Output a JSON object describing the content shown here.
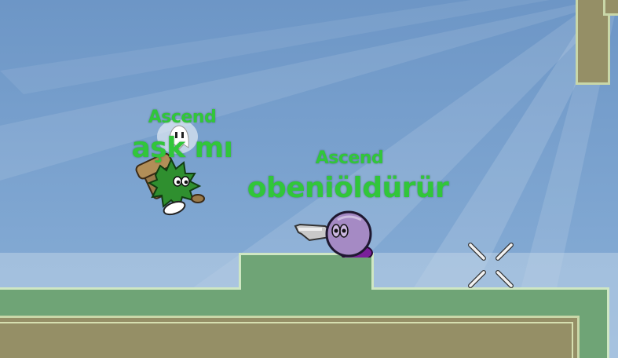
{
  "players": [
    {
      "clan": "Ascend",
      "name": "aşk mı"
    },
    {
      "clan": "Ascend",
      "name": "obeniöldürür"
    }
  ],
  "icons": {
    "player1_body": "green-spiky-tee-icon",
    "player2_body": "purple-tee-icon",
    "player1_emote": "ghost-emote-icon",
    "player1_weapon": "hammer-icon",
    "player2_weapon": "pistol-icon",
    "crosshair": "crosshair-icon"
  },
  "colors": {
    "sky": "#6d96c6",
    "grass": "#6fa476",
    "dirt": "#958f66",
    "nameplate": "#31c63a"
  }
}
